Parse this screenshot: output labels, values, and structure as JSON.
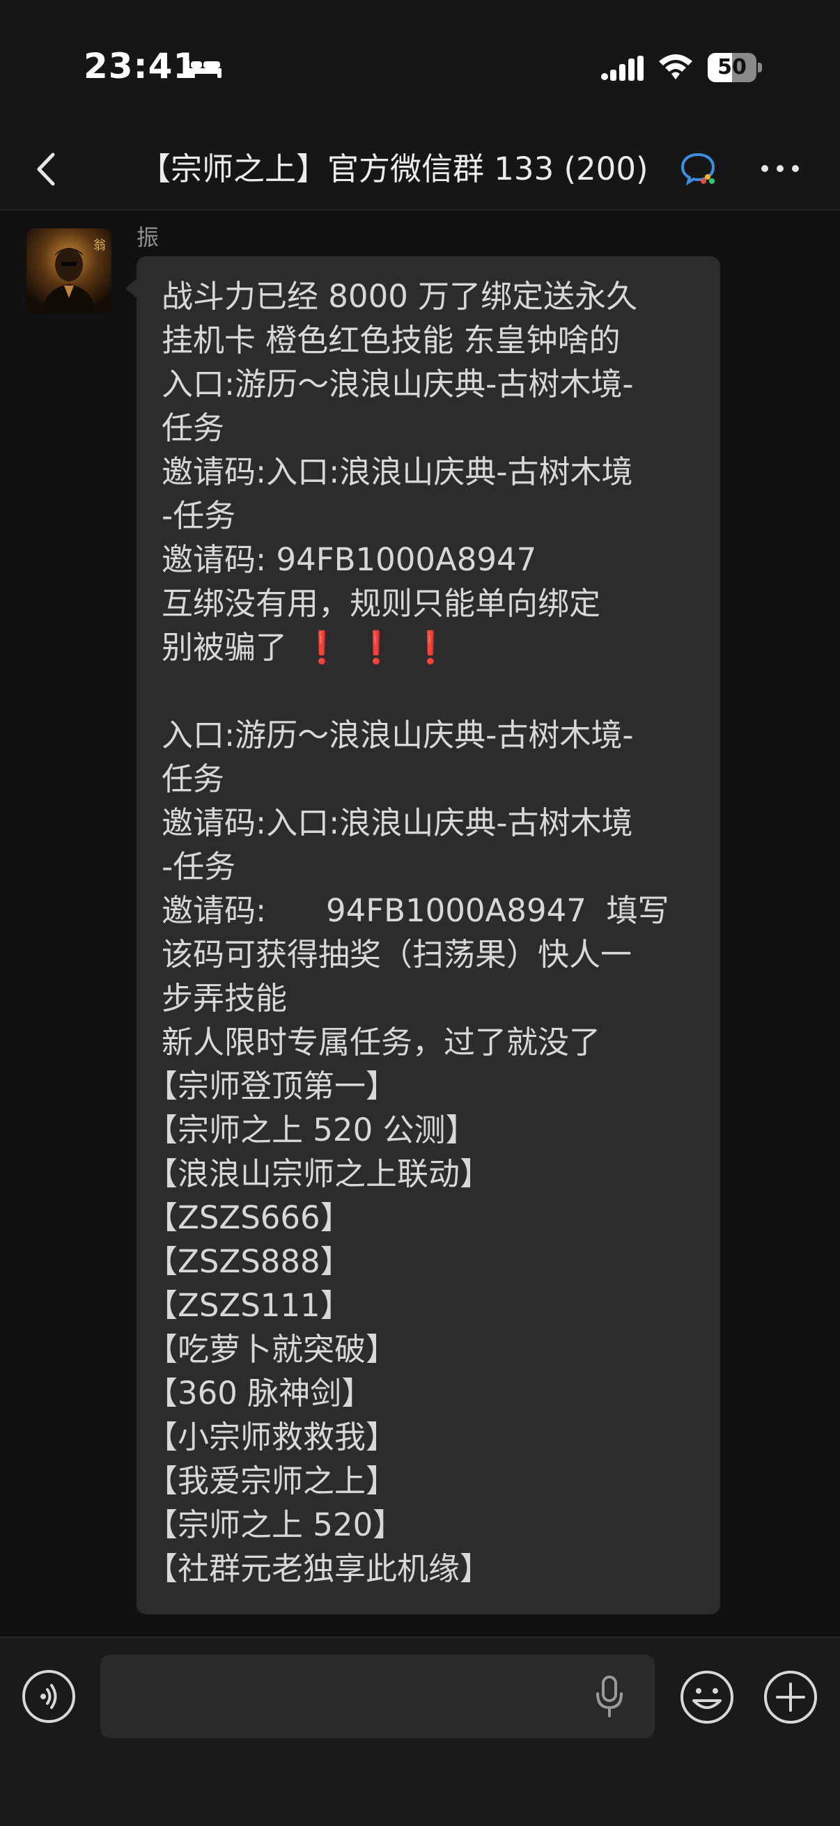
{
  "status_bar": {
    "time": "23:41",
    "battery_level": "50",
    "battery_percent": 50
  },
  "header": {
    "title": "【宗师之上】官方微信群 133 (200)",
    "back_icon": "chevron-left-icon",
    "enterprise_icon": "wecom-chat-icon",
    "more_icon": "more-dots-icon"
  },
  "message": {
    "sender": "振",
    "lines": [
      "战斗力已经 8000 万了绑定送永久",
      "挂机卡 橙色红色技能 东皇钟啥的",
      "入口:游历～浪浪山庆典-古树木境-",
      "任务",
      "邀请码:入口:浪浪山庆典-古树木境",
      "-任务",
      "邀请码: 94FB1000A8947",
      "互绑没有用，规则只能单向绑定",
      "别被骗了",
      "",
      "入口:游历～浪浪山庆典-古树木境-",
      "任务",
      "邀请码:入口:浪浪山庆典-古树木境",
      "-任务",
      "邀请码:      94FB1000A8947  填写",
      "该码可获得抽奖（扫荡果）快人一",
      "步弄技能",
      "新人限时专属任务，过了就没了"
    ],
    "exclamation_marks": [
      "❗",
      "❗",
      "❗"
    ],
    "codes": [
      "【宗师登顶第一】",
      "【宗师之上 520 公测】",
      "【浪浪山宗师之上联动】",
      "【ZSZS666】",
      "【ZSZS888】",
      "【ZSZS111】",
      "【吃萝卜就突破】",
      "【360 脉神剑】",
      "【小宗师救救我】",
      "【我爱宗师之上】",
      "【宗师之上 520】",
      "【社群元老独享此机缘】"
    ]
  },
  "input_bar": {
    "placeholder": "",
    "voice_icon": "voice-wave-icon",
    "mic_icon": "microphone-icon",
    "emoji_icon": "smiley-icon",
    "add_icon": "plus-circle-icon"
  }
}
